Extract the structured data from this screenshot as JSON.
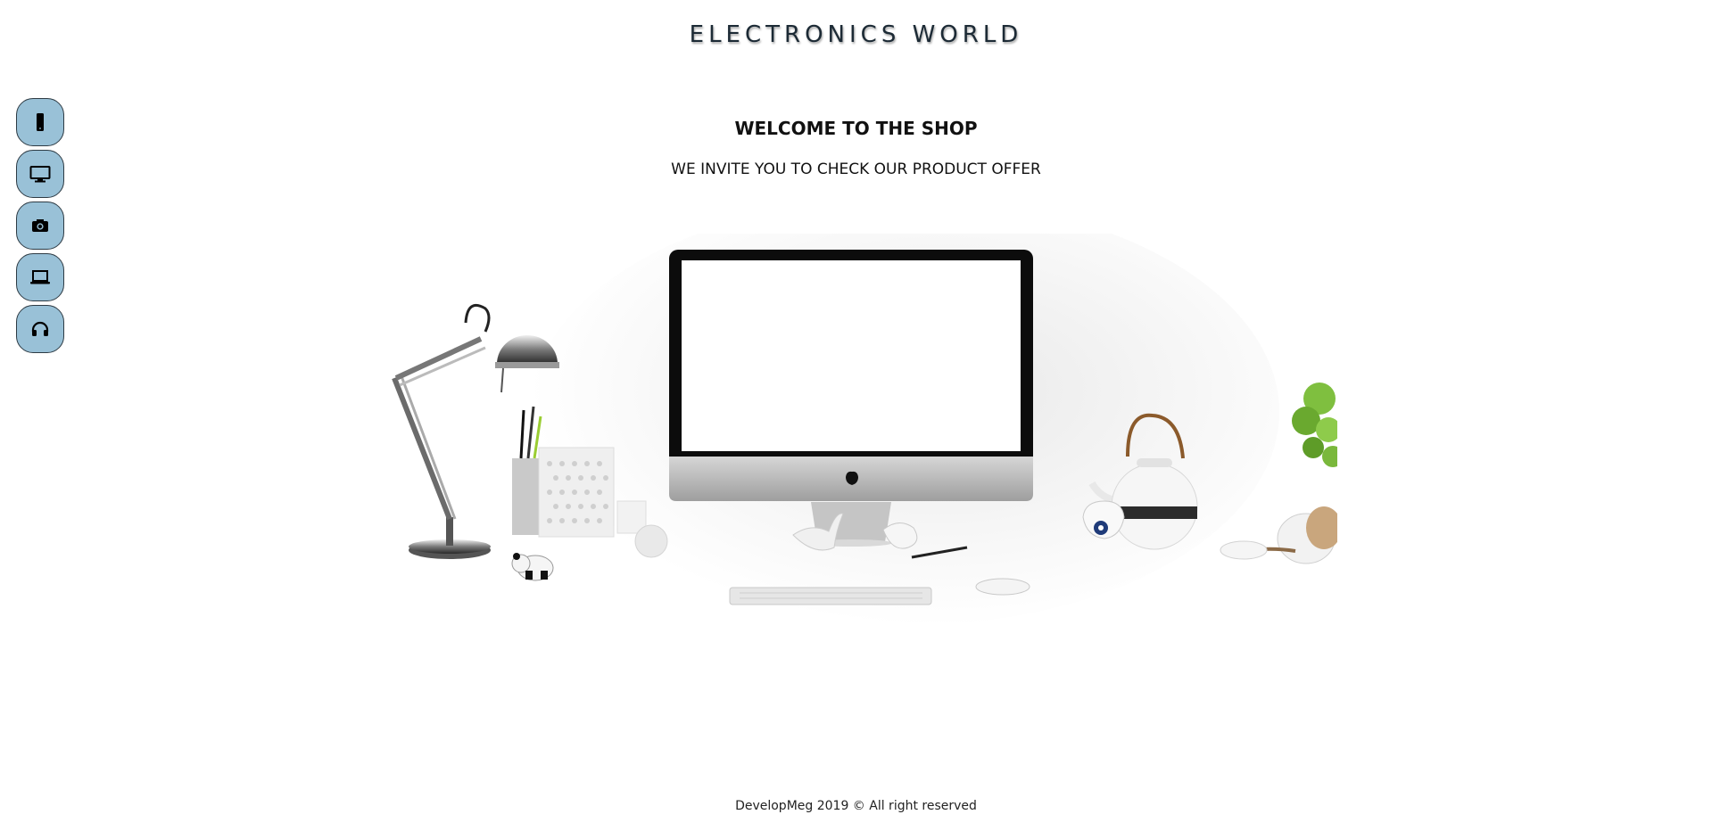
{
  "header": {
    "title": "ELECTRONICS WORLD"
  },
  "sidebar": {
    "items": [
      {
        "name": "phone",
        "icon": "smartphone-icon"
      },
      {
        "name": "monitor",
        "icon": "desktop-monitor-icon"
      },
      {
        "name": "camera",
        "icon": "camera-icon"
      },
      {
        "name": "laptop",
        "icon": "laptop-icon"
      },
      {
        "name": "headphones",
        "icon": "headphones-icon"
      }
    ],
    "button_color": "#99c1d7"
  },
  "main": {
    "heading": "WELCOME TO THE SHOP",
    "subheading": "WE INVITE YOU TO CHECK OUR PRODUCT OFFER"
  },
  "footer": {
    "text": "DevelopMeg 2019 © All right reserved"
  }
}
